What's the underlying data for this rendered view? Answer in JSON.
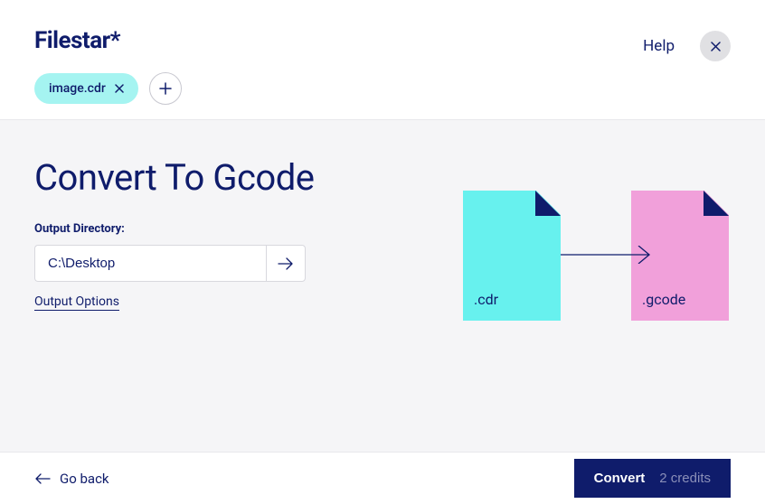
{
  "header": {
    "logo": "Filestar*",
    "help_label": "Help"
  },
  "file": {
    "name": "image.cdr"
  },
  "page": {
    "title": "Convert To Gcode"
  },
  "form": {
    "output_dir_label": "Output Directory:",
    "output_dir_value": "C:\\Desktop",
    "output_options_label": "Output Options"
  },
  "diagram": {
    "from_ext": ".cdr",
    "to_ext": ".gcode"
  },
  "footer": {
    "go_back_label": "Go back",
    "convert_label": "Convert",
    "credits_label": "2 credits"
  },
  "colors": {
    "primary": "#0f1c6b",
    "chip_bg": "#a5f4f1",
    "file_cyan": "#67f1ee",
    "file_pink": "#f1a0da",
    "page_bg": "#f5f5f7"
  }
}
